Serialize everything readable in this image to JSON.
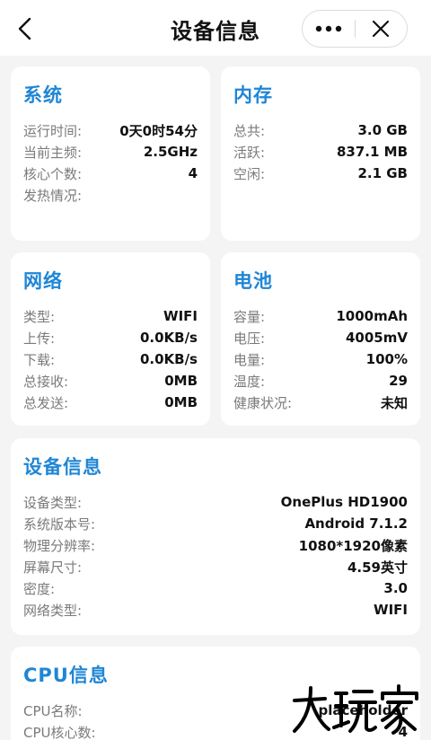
{
  "header": {
    "title": "设备信息",
    "back_icon": "chevron-left-icon",
    "more_icon": "more-dots-icon",
    "close_icon": "close-icon"
  },
  "system": {
    "title": "系统",
    "rows": [
      {
        "k": "运行时间:",
        "v": "0天0时54分"
      },
      {
        "k": "当前主频:",
        "v": "2.5GHz"
      },
      {
        "k": "核心个数:",
        "v": "4"
      },
      {
        "k": "发热情况:",
        "v": ""
      }
    ]
  },
  "memory": {
    "title": "内存",
    "rows": [
      {
        "k": "总共:",
        "v": "3.0 GB"
      },
      {
        "k": "活跃:",
        "v": "837.1 MB"
      },
      {
        "k": "空闲:",
        "v": "2.1 GB"
      }
    ]
  },
  "network": {
    "title": "网络",
    "rows": [
      {
        "k": "类型:",
        "v": "WIFI"
      },
      {
        "k": "上传:",
        "v": "0.0KB/s"
      },
      {
        "k": "下载:",
        "v": "0.0KB/s"
      },
      {
        "k": "总接收:",
        "v": "0MB"
      },
      {
        "k": "总发送:",
        "v": "0MB"
      }
    ]
  },
  "battery": {
    "title": "电池",
    "rows": [
      {
        "k": "容量:",
        "v": "1000mAh"
      },
      {
        "k": "电压:",
        "v": "4005mV"
      },
      {
        "k": "电量:",
        "v": "100%"
      },
      {
        "k": "温度:",
        "v": "29"
      },
      {
        "k": "健康状况:",
        "v": "未知"
      }
    ]
  },
  "device": {
    "title": "设备信息",
    "rows": [
      {
        "k": "设备类型:",
        "v": "OnePlus HD1900"
      },
      {
        "k": "系统版本号:",
        "v": "Android 7.1.2"
      },
      {
        "k": "物理分辨率:",
        "v": "1080*1920像素"
      },
      {
        "k": "屏幕尺寸:",
        "v": "4.59英寸"
      },
      {
        "k": "密度:",
        "v": "3.0"
      },
      {
        "k": "网络类型:",
        "v": "WIFI"
      }
    ]
  },
  "cpu": {
    "title": "CPU信息",
    "rows": [
      {
        "k": "CPU名称:",
        "v": "placeholder"
      },
      {
        "k": "CPU核心数:",
        "v": "4"
      }
    ]
  },
  "watermark": {
    "text": "大玩家",
    "color": "#000000"
  },
  "colors": {
    "accent": "#1f86d6",
    "background": "#f4f4f4",
    "card": "#ffffff"
  }
}
